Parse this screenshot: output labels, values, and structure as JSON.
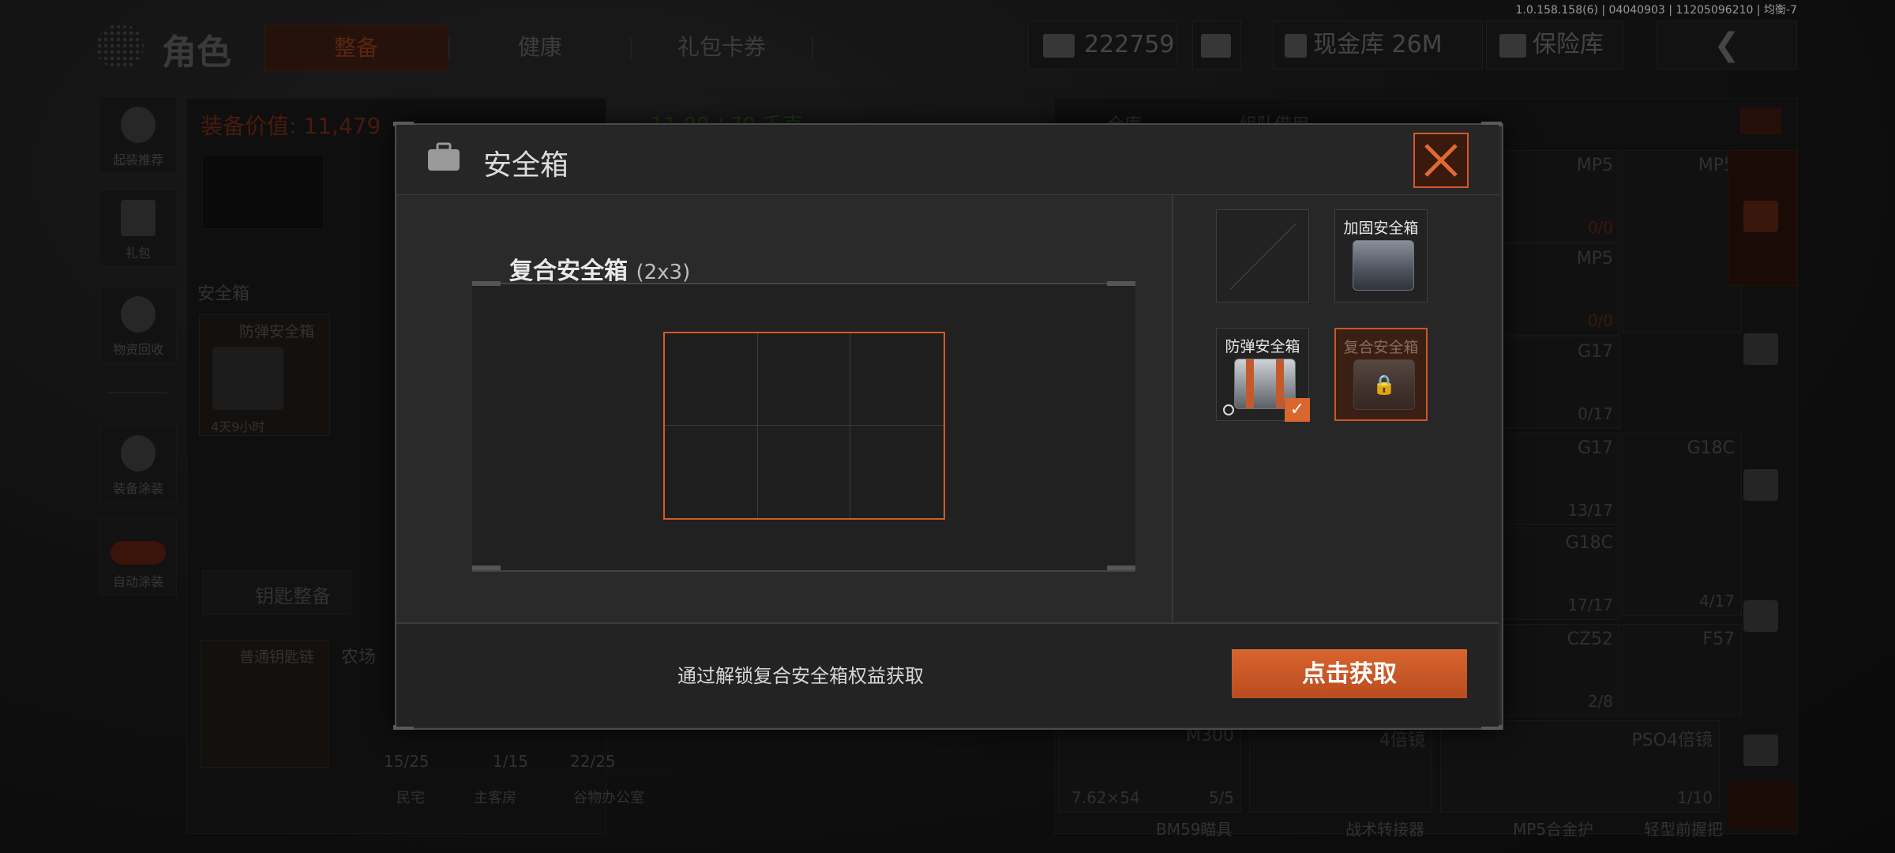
{
  "version": "1.0.158.158(6) | 04040903 | 11205096210 | 均衡-7",
  "header": {
    "title": "角色",
    "tabs": [
      {
        "label": "整备",
        "active": true
      },
      {
        "label": "健康",
        "active": false
      },
      {
        "label": "礼包卡券",
        "active": false
      }
    ],
    "currency_value": "222759",
    "cash_vault": "现金库 26M",
    "insurance_vault": "保险库"
  },
  "sidebar": {
    "items": [
      {
        "label": "起装推荐"
      },
      {
        "label": "礼包"
      },
      {
        "label": "物资回收"
      },
      {
        "label": "装备涂装"
      },
      {
        "label": "自动涂装"
      }
    ]
  },
  "left_panel": {
    "equipment_value": "装备价值: 11,479",
    "weight": "11.88 / 70 千克",
    "safe_box_section": "安全箱",
    "safe_box_item": "防弹安全箱",
    "safe_box_timer": "4天9小时",
    "key_section": "钥匙整备",
    "keychain": "普通钥匙链",
    "location": "农场",
    "key_slots": [
      {
        "count": "15/25"
      },
      {
        "count": "1/15"
      },
      {
        "count": "22/25"
      }
    ],
    "key_names": [
      "民宅",
      "主客房",
      "谷物办公室"
    ]
  },
  "right_panel": {
    "tabs": [
      "仓库",
      "组队借用"
    ],
    "items": [
      {
        "name": "MP5",
        "count": "0/0"
      },
      {
        "name": "MP5",
        "count": ""
      },
      {
        "name": "MP5",
        "count": "0/0"
      },
      {
        "name": "G17",
        "count": "0/17"
      },
      {
        "name": "G17",
        "count": "13/17"
      },
      {
        "name": "G18C",
        "count": ""
      },
      {
        "name": "G18C",
        "count": "17/17"
      },
      {
        "name": "",
        "count": "4/17"
      },
      {
        "name": "CZ52",
        "count": "2/8"
      },
      {
        "name": "F57",
        "count": ""
      },
      {
        "name": "M300",
        "count": "5/5"
      },
      {
        "name": "4倍镜",
        "count": ""
      },
      {
        "name": "PSO4倍镜",
        "count": "1/10"
      }
    ],
    "ammo_label": "7.62×54",
    "bottom_row": [
      "BM59瞄具",
      "战术转接器",
      "MP5合金护",
      "轻型前握把"
    ]
  },
  "modal": {
    "title": "安全箱",
    "case_name": "复合安全箱",
    "case_size": "(2x3)",
    "options": [
      {
        "label": "",
        "state": "empty"
      },
      {
        "label": "加固安全箱",
        "state": "available"
      },
      {
        "label": "防弹安全箱",
        "state": "equipped"
      },
      {
        "label": "复合安全箱",
        "state": "locked"
      }
    ],
    "footer_hint": "通过解锁复合安全箱权益获取",
    "action_button": "点击获取"
  },
  "colors": {
    "accent": "#d45a2a",
    "button": "#c9572a",
    "modal_bg": "#2b2b2b"
  }
}
